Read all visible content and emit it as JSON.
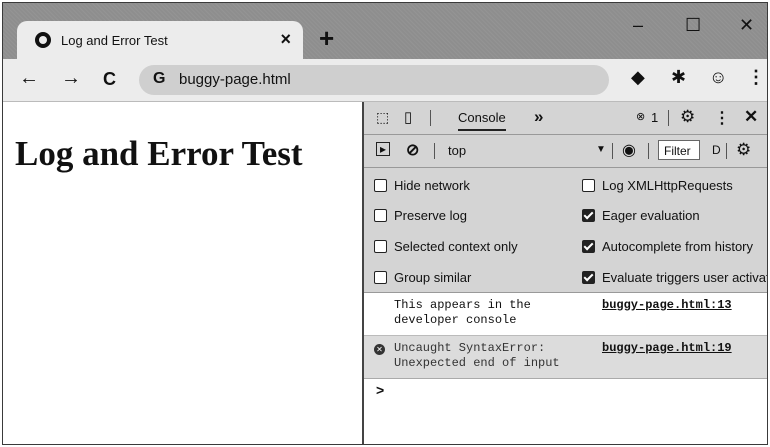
{
  "browser": {
    "tab_title": "Log and Error Test",
    "tab_close": "×",
    "new_tab": "+",
    "minimize": "–",
    "maximize": "☐",
    "close": "✕",
    "back": "←",
    "forward": "→",
    "reload": "C",
    "site_icon": "G",
    "url": "buggy-page.html",
    "menu": "⋮"
  },
  "page": {
    "heading": "Log and Error Test"
  },
  "devtools": {
    "panel_tab": "Console",
    "more_tabs": "»",
    "error_count": "1",
    "context": "top",
    "filter_label": "Filter",
    "levels_partial": "D",
    "settings": {
      "left": [
        {
          "label": "Hide network",
          "checked": false
        },
        {
          "label": "Preserve log",
          "checked": false
        },
        {
          "label": "Selected context only",
          "checked": false
        },
        {
          "label": "Group similar",
          "checked": false
        }
      ],
      "right": [
        {
          "label": "Log XMLHttpRequests",
          "checked": false
        },
        {
          "label": "Eager evaluation",
          "checked": true
        },
        {
          "label": "Autocomplete from history",
          "checked": true
        },
        {
          "label": "Evaluate triggers user activation",
          "checked": true
        }
      ]
    },
    "messages": [
      {
        "text": "This appears in the\ndeveloper console",
        "source": "buggy-page.html:13",
        "level": "log"
      },
      {
        "text": "Uncaught SyntaxError:\nUnexpected end of input",
        "source": "buggy-page.html:19",
        "level": "error"
      }
    ],
    "prompt": ">"
  }
}
